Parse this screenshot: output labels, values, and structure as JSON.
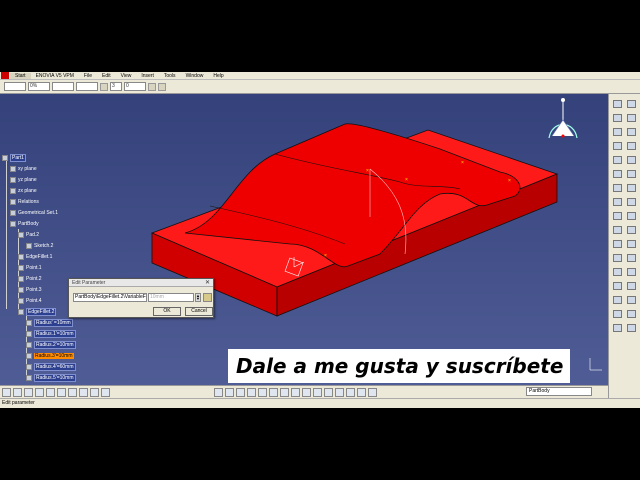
{
  "menu": {
    "items": [
      "Start",
      "ENOVIA V5 VPM",
      "File",
      "Edit",
      "View",
      "Insert",
      "Tools",
      "Window",
      "Help"
    ]
  },
  "toolbar": {
    "line_weight": "0%",
    "layer": "3",
    "value_field": "0"
  },
  "tree": {
    "root": "Part1",
    "planes": [
      "xy plane",
      "yz plane",
      "zx plane"
    ],
    "relations": "Relations",
    "geo_set": "Geometrical Set.1",
    "part_body": "PartBody",
    "pad": "Pad.2",
    "sketch": "Sketch.2",
    "edge_fillet_1": "EdgeFillet.1",
    "points": [
      "Point.1",
      "Point.2",
      "Point.3",
      "Point.4"
    ],
    "edge_fillet_2": "EdgeFillet.2",
    "radii": [
      "Radius' =10mm",
      "Radius.1'=10mm",
      "Radius.2'=10mm",
      "Radius.3'=10mm",
      "Radius.4'=60mm",
      "Radius.5'=10mm"
    ]
  },
  "dialog": {
    "title": "Edit Parameter",
    "close": "✕",
    "path": "PartBody\\EdgeFillet.2\\VariableFill",
    "value": "10mm",
    "ok": "OK",
    "cancel": "Cancel"
  },
  "bottom": {
    "part_select": "PartBody"
  },
  "status": {
    "text": "Edit parameter"
  },
  "overlay": {
    "text": "Dale a me gusta y suscríbete"
  },
  "colors": {
    "model": "#e10000",
    "background": "#3f4a7f",
    "highlight": "#ff8c00"
  }
}
